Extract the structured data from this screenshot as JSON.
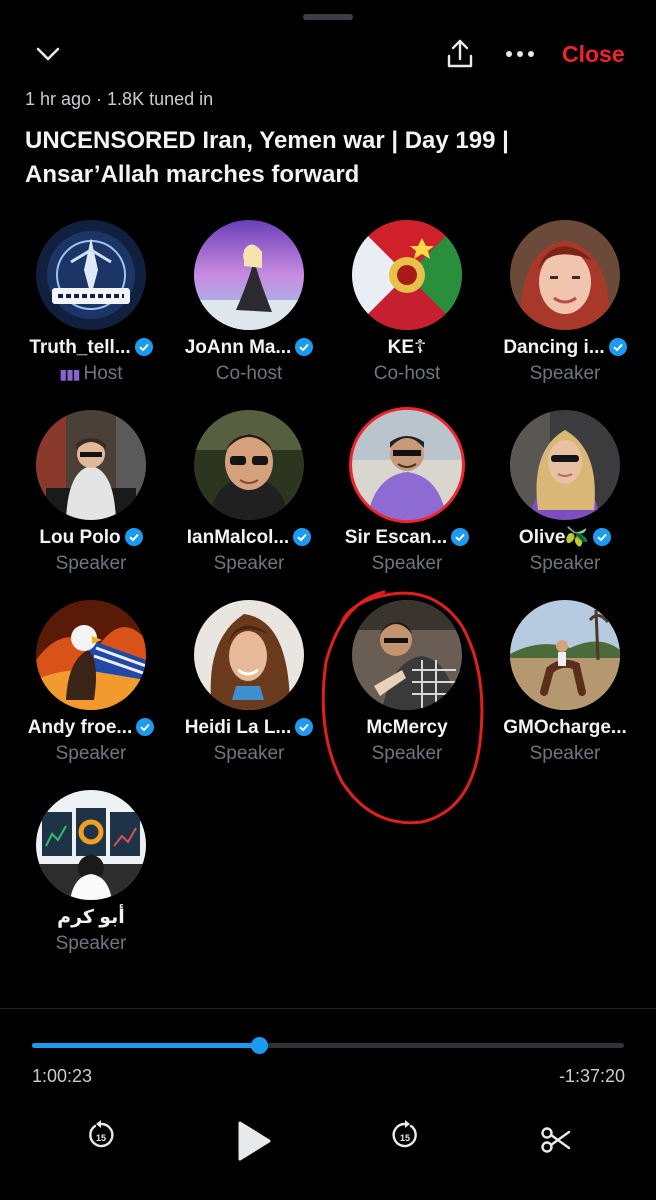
{
  "header": {
    "close_label": "Close",
    "meta": "1 hr ago · 1.8K tuned in",
    "title": "UNCENSORED Iran, Yemen war | Day 199 | Ansar’Allah marches forward"
  },
  "colors": {
    "accent": "#1d9bf0",
    "close": "#f4212e",
    "muted": "#6e767d",
    "host_bars": "#8a63d2"
  },
  "participants": [
    {
      "name": "Truth_tell...",
      "role": "Host",
      "verified": true,
      "avatar": "truth-teller-logo"
    },
    {
      "name": "JoAnn Ma...",
      "role": "Co-host",
      "verified": true,
      "avatar": "woman-on-beach-aurora"
    },
    {
      "name": "KE☦",
      "role": "Co-host",
      "verified": false,
      "avatar": "flags-collage"
    },
    {
      "name": "Dancing i...",
      "role": "Speaker",
      "verified": true,
      "avatar": "woman-red-hair"
    },
    {
      "name": "Lou Polo",
      "role": "Speaker",
      "verified": true,
      "avatar": "dj-booth"
    },
    {
      "name": "IanMalcol...",
      "role": "Speaker",
      "verified": true,
      "avatar": "man-sunglasses"
    },
    {
      "name": "Sir Escan...",
      "role": "Speaker",
      "verified": true,
      "avatar": "man-purple-shirt"
    },
    {
      "name": "Olive🫒",
      "role": "Speaker",
      "verified": true,
      "avatar": "woman-blonde-car"
    },
    {
      "name": "Andy froe...",
      "role": "Speaker",
      "verified": true,
      "avatar": "eagle-flag"
    },
    {
      "name": "Heidi La L...",
      "role": "Speaker",
      "verified": true,
      "avatar": "woman-curly-hair"
    },
    {
      "name": "McMercy",
      "role": "Speaker",
      "verified": false,
      "avatar": "man-writing"
    },
    {
      "name": "GMOcharge...",
      "role": "Speaker",
      "verified": false,
      "avatar": "horse-rider"
    },
    {
      "name": "أبو كرم",
      "role": "Speaker",
      "verified": false,
      "avatar": "trader-monitors"
    }
  ],
  "player": {
    "elapsed": "1:00:23",
    "remaining": "-1:37:20",
    "progress": 0.384
  }
}
